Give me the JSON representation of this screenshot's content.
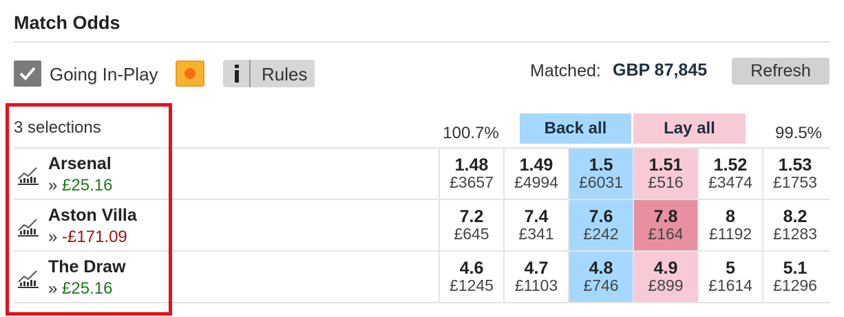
{
  "market": {
    "title": "Match Odds",
    "going_in_play_label": "Going In-Play",
    "rules_label": "Rules",
    "info_icon": "i",
    "matched_label": "Matched:",
    "matched_value": "GBP 87,845",
    "refresh_label": "Refresh"
  },
  "header": {
    "selections_count": "3 selections",
    "back_overround": "100.7%",
    "lay_overround": "99.5%",
    "back_all_label": "Back all",
    "lay_all_label": "Lay all"
  },
  "colors": {
    "back": "#a6d8ff",
    "lay": "#f8cad6",
    "lay_highlight": "#e88fa2",
    "profit": "#1a7a1a",
    "loss": "#9b1111",
    "in_play_badge": "#f7b231",
    "annotation_box": "#e5101b"
  },
  "runners": [
    {
      "name": "Arsenal",
      "pl_arrow": "»",
      "pl": "£25.16",
      "odds": [
        {
          "price": "1.48",
          "size": "£3657"
        },
        {
          "price": "1.49",
          "size": "£4994"
        },
        {
          "price": "1.5",
          "size": "£6031"
        },
        {
          "price": "1.51",
          "size": "£516"
        },
        {
          "price": "1.52",
          "size": "£3474"
        },
        {
          "price": "1.53",
          "size": "£1753"
        }
      ]
    },
    {
      "name": "Aston Villa",
      "pl_arrow": "»",
      "pl": "-£171.09",
      "odds": [
        {
          "price": "7.2",
          "size": "£645"
        },
        {
          "price": "7.4",
          "size": "£341"
        },
        {
          "price": "7.6",
          "size": "£242"
        },
        {
          "price": "7.8",
          "size": "£164"
        },
        {
          "price": "8",
          "size": "£1192"
        },
        {
          "price": "8.2",
          "size": "£1283"
        }
      ]
    },
    {
      "name": "The Draw",
      "pl_arrow": "»",
      "pl": "£25.16",
      "odds": [
        {
          "price": "4.6",
          "size": "£1245"
        },
        {
          "price": "4.7",
          "size": "£1103"
        },
        {
          "price": "4.8",
          "size": "£746"
        },
        {
          "price": "4.9",
          "size": "£899"
        },
        {
          "price": "5",
          "size": "£1614"
        },
        {
          "price": "5.1",
          "size": "£1296"
        }
      ]
    }
  ]
}
